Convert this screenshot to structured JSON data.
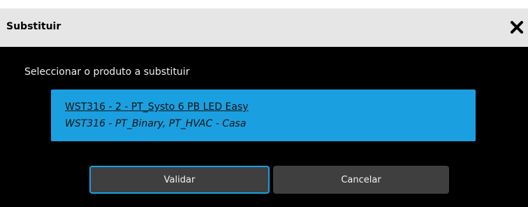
{
  "dialog": {
    "title": "Substituir",
    "close_icon": "close-icon",
    "prompt": "Seleccionar o produto a substituir",
    "product": {
      "name": "WST316 - 2 - PT_Systo 6 PB LED Easy",
      "detail": "WST316 - PT_Binary, PT_HVAC - Casa"
    },
    "buttons": {
      "validate_label": "Validar",
      "cancel_label": "Cancelar"
    }
  },
  "colors": {
    "titlebar": "#e6e6e6",
    "background": "#000000",
    "accent": "#1aa0e0",
    "button": "#3f3f3f"
  }
}
